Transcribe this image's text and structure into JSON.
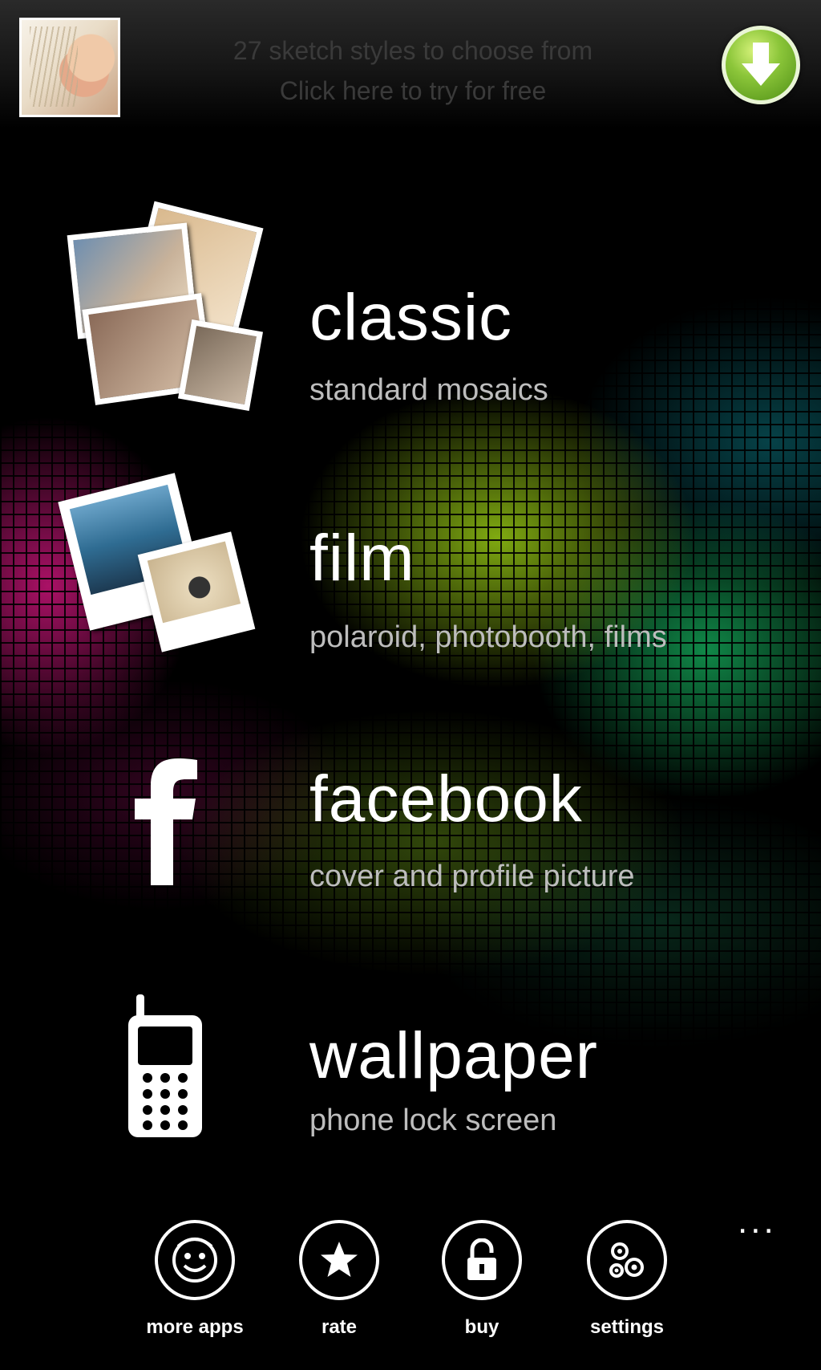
{
  "promo": {
    "line1": "27 sketch styles to choose from",
    "line2": "Click here to try for free",
    "download_icon": "download-arrow-icon"
  },
  "menu": [
    {
      "title": "classic",
      "subtitle": "standard mosaics",
      "icon": "photo-stack-icon"
    },
    {
      "title": "film",
      "subtitle": "polaroid, photobooth, films",
      "icon": "polaroid-icon"
    },
    {
      "title": "facebook",
      "subtitle": "cover and profile picture",
      "icon": "facebook-icon"
    },
    {
      "title": "wallpaper",
      "subtitle": "phone lock screen",
      "icon": "phone-icon"
    }
  ],
  "appbar": {
    "buttons": [
      {
        "label": "more apps",
        "icon": "smiley-icon"
      },
      {
        "label": "rate",
        "icon": "star-icon"
      },
      {
        "label": "buy",
        "icon": "unlock-icon"
      },
      {
        "label": "settings",
        "icon": "gears-icon"
      }
    ],
    "more": "..."
  },
  "colors": {
    "download_green": "#8cc63a",
    "subtitle_gray": "#bdbdbd",
    "promo_text": "#3a3a3a"
  }
}
